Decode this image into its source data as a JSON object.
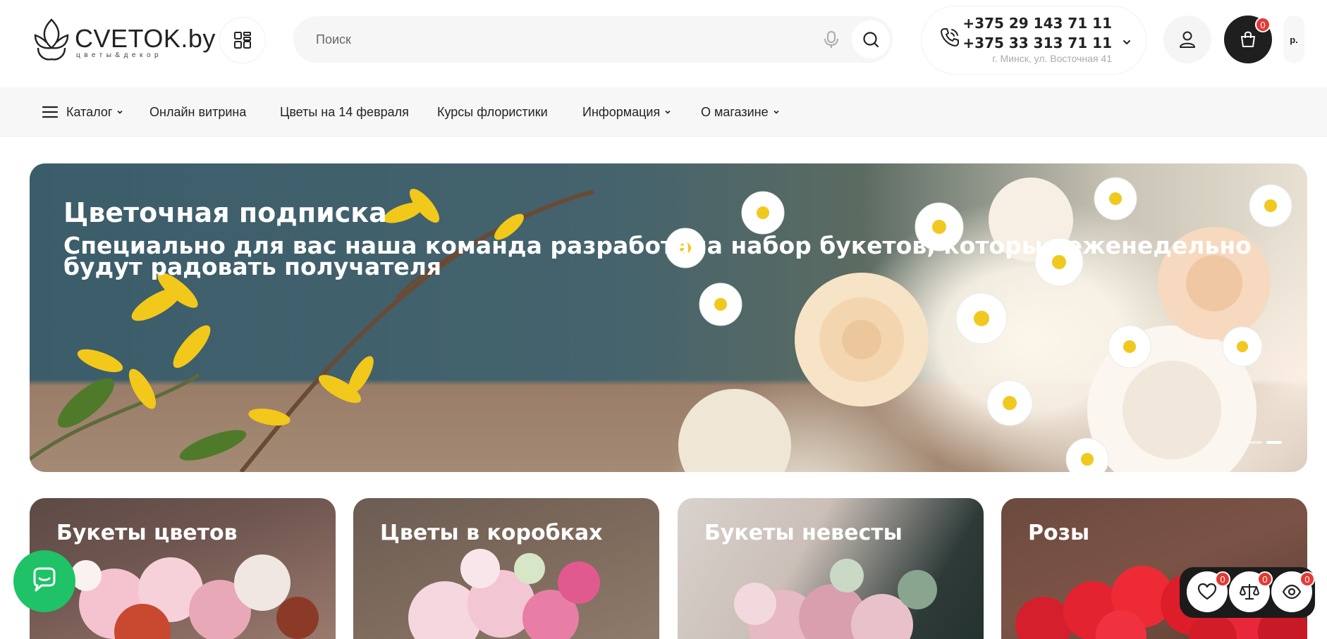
{
  "header": {
    "logo_text": "CVETOK.by",
    "logo_tagline": "цветы&декор",
    "search_placeholder": "Поиск",
    "phones": [
      "+375 29 143 71 11",
      "+375 33 313 71 11"
    ],
    "address": "г. Минск, ул. Восточная 41",
    "cart_count": "0",
    "currency": "р."
  },
  "nav": {
    "items": [
      {
        "label": "Каталог"
      },
      {
        "label": "Онлайн витрина"
      },
      {
        "label": "Цветы на 14 февраля"
      },
      {
        "label": "Курсы флористики"
      },
      {
        "label": "Информация"
      },
      {
        "label": "О магазине"
      }
    ]
  },
  "hero": {
    "title": "Цветочная подписка",
    "subtitle": "Специально для вас наша команда разработала набор букетов, которые еженедельно будут радовать получателя"
  },
  "categories": [
    {
      "title": "Букеты цветов"
    },
    {
      "title": "Цветы в коробках"
    },
    {
      "title": "Букеты невесты"
    },
    {
      "title": "Розы"
    }
  ],
  "widget": {
    "favorites_count": "0",
    "compare_count": "0",
    "viewed_count": "0"
  },
  "colors": {
    "accent_green": "#1fc267",
    "badge_red": "#e53935",
    "dark": "#1f1f1f"
  },
  "icons": [
    "catalog-grid-icon",
    "mic-icon",
    "search-icon",
    "phone-icon",
    "user-icon",
    "bag-icon",
    "hamburger-icon",
    "chat-icon",
    "heart-icon",
    "scales-icon",
    "eye-icon"
  ]
}
